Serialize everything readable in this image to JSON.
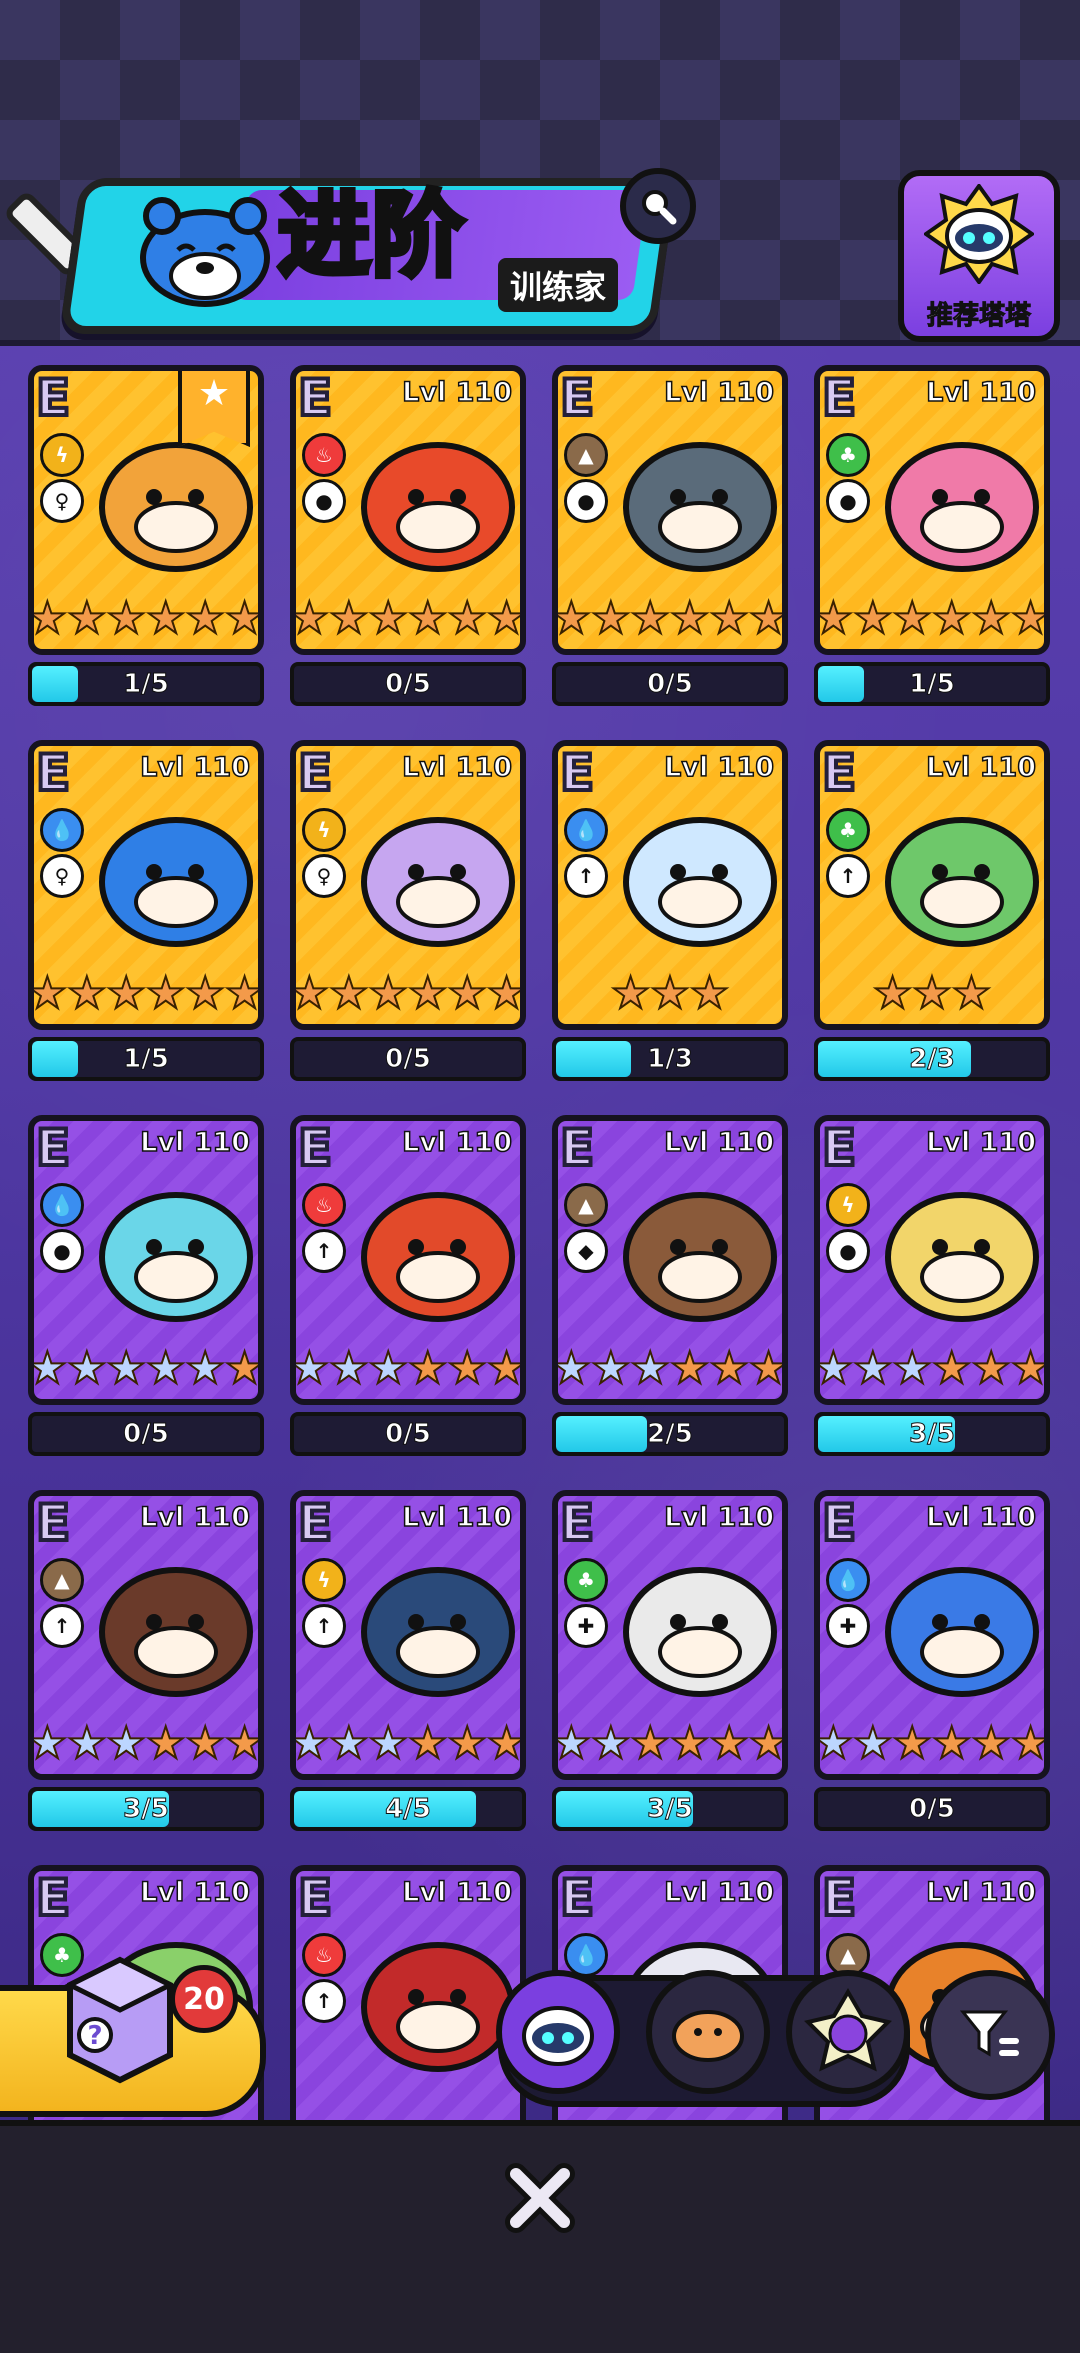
{
  "header": {
    "title": "进阶",
    "subtitle": "训练家",
    "recommend_label": "推荐塔塔"
  },
  "colors": {
    "fire": "#ef3b3b",
    "water": "#3a8ef0",
    "earth": "#8a6a4a",
    "grass": "#3fbf4a",
    "electric": "#f2b21a",
    "progress": "#3ee0f5"
  },
  "cards": [
    {
      "grade": "E",
      "level": "",
      "element": "electric",
      "role": "support",
      "stars_blue": 0,
      "stars_total": 6,
      "progress_text": "1/5",
      "progress": 0.2,
      "frame": "gold",
      "favorite": true
    },
    {
      "grade": "E",
      "level": "Lvl 110",
      "element": "fire",
      "role": "tank",
      "stars_blue": 0,
      "stars_total": 6,
      "progress_text": "0/5",
      "progress": 0,
      "frame": "gold",
      "favorite": false
    },
    {
      "grade": "E",
      "level": "Lvl 110",
      "element": "earth",
      "role": "tank",
      "stars_blue": 0,
      "stars_total": 6,
      "progress_text": "0/5",
      "progress": 0,
      "frame": "gold",
      "favorite": false
    },
    {
      "grade": "E",
      "level": "Lvl 110",
      "element": "grass",
      "role": "tank",
      "stars_blue": 0,
      "stars_total": 6,
      "progress_text": "1/5",
      "progress": 0.2,
      "frame": "gold",
      "favorite": false
    },
    {
      "grade": "E",
      "level": "Lvl 110",
      "element": "water",
      "role": "support",
      "stars_blue": 0,
      "stars_total": 6,
      "progress_text": "1/5",
      "progress": 0.2,
      "frame": "gold",
      "favorite": false
    },
    {
      "grade": "E",
      "level": "Lvl 110",
      "element": "electric",
      "role": "support",
      "stars_blue": 0,
      "stars_total": 6,
      "progress_text": "0/5",
      "progress": 0,
      "frame": "gold",
      "favorite": false
    },
    {
      "grade": "E",
      "level": "Lvl 110",
      "element": "water",
      "role": "attack",
      "stars_blue": 0,
      "stars_total": 3,
      "progress_text": "1/3",
      "progress": 0.33,
      "frame": "gold",
      "favorite": false
    },
    {
      "grade": "E",
      "level": "Lvl 110",
      "element": "grass",
      "role": "attack",
      "stars_blue": 0,
      "stars_total": 3,
      "progress_text": "2/3",
      "progress": 0.67,
      "frame": "gold",
      "favorite": false
    },
    {
      "grade": "E",
      "level": "Lvl 110",
      "element": "water",
      "role": "tank",
      "stars_blue": 5,
      "stars_total": 6,
      "progress_text": "0/5",
      "progress": 0,
      "frame": "purple",
      "favorite": false
    },
    {
      "grade": "E",
      "level": "Lvl 110",
      "element": "fire",
      "role": "attack",
      "stars_blue": 3,
      "stars_total": 6,
      "progress_text": "0/5",
      "progress": 0,
      "frame": "purple",
      "favorite": false
    },
    {
      "grade": "E",
      "level": "Lvl 110",
      "element": "earth",
      "role": "defense",
      "stars_blue": 3,
      "stars_total": 6,
      "progress_text": "2/5",
      "progress": 0.4,
      "frame": "purple",
      "favorite": false
    },
    {
      "grade": "E",
      "level": "Lvl 110",
      "element": "electric",
      "role": "tank",
      "stars_blue": 3,
      "stars_total": 6,
      "progress_text": "3/5",
      "progress": 0.6,
      "frame": "purple",
      "favorite": false
    },
    {
      "grade": "E",
      "level": "Lvl 110",
      "element": "earth",
      "role": "attack",
      "stars_blue": 3,
      "stars_total": 6,
      "progress_text": "3/5",
      "progress": 0.6,
      "frame": "purple",
      "favorite": false
    },
    {
      "grade": "E",
      "level": "Lvl 110",
      "element": "electric",
      "role": "attack",
      "stars_blue": 3,
      "stars_total": 6,
      "progress_text": "4/5",
      "progress": 0.8,
      "frame": "purple",
      "favorite": false
    },
    {
      "grade": "E",
      "level": "Lvl 110",
      "element": "grass",
      "role": "heal",
      "stars_blue": 2,
      "stars_total": 6,
      "progress_text": "3/5",
      "progress": 0.6,
      "frame": "purple",
      "favorite": false
    },
    {
      "grade": "E",
      "level": "Lvl 110",
      "element": "water",
      "role": "heal",
      "stars_blue": 2,
      "stars_total": 6,
      "progress_text": "0/5",
      "progress": 0,
      "frame": "purple",
      "favorite": false
    },
    {
      "grade": "E",
      "level": "Lvl 110",
      "element": "grass",
      "role": "",
      "stars_blue": 0,
      "stars_total": 0,
      "progress_text": "",
      "progress": 0,
      "frame": "purple",
      "favorite": false
    },
    {
      "grade": "E",
      "level": "Lvl 110",
      "element": "fire",
      "role": "attack",
      "stars_blue": 0,
      "stars_total": 0,
      "progress_text": "",
      "progress": 0,
      "frame": "purple",
      "favorite": false
    },
    {
      "grade": "E",
      "level": "Lvl 110",
      "element": "water",
      "role": "",
      "stars_blue": 0,
      "stars_total": 0,
      "progress_text": "",
      "progress": 0,
      "frame": "purple",
      "favorite": false
    },
    {
      "grade": "E",
      "level": "Lvl 110",
      "element": "earth",
      "role": "",
      "stars_blue": 0,
      "stars_total": 0,
      "progress_text": "",
      "progress": 0,
      "frame": "purple",
      "favorite": false
    }
  ],
  "bag": {
    "count": "20"
  },
  "tabs": [
    {
      "icon": "robot-cat-icon"
    },
    {
      "icon": "hamster-icon"
    },
    {
      "icon": "cat-gem-icon"
    }
  ],
  "icons": {
    "search": "search-icon",
    "filter": "filter-icon",
    "close": "close-icon"
  }
}
